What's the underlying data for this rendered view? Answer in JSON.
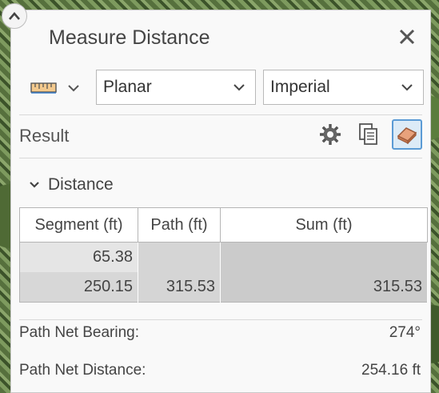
{
  "window": {
    "title": "Measure Distance"
  },
  "toolbar": {
    "mode_selected": "Planar",
    "units_selected": "Imperial"
  },
  "result": {
    "label": "Result"
  },
  "distance": {
    "section_label": "Distance",
    "headers": [
      "Segment (ft)",
      "Path (ft)",
      "Sum (ft)"
    ],
    "rows": [
      {
        "segment": "65.38",
        "path": "",
        "sum": ""
      },
      {
        "segment": "250.15",
        "path": "315.53",
        "sum": "315.53"
      }
    ]
  },
  "summary": {
    "bearing_label": "Path Net Bearing:",
    "bearing_value": "274°",
    "distance_label": "Path Net Distance:",
    "distance_value": "254.16 ft"
  },
  "colors": {
    "accent": "#5b9bd5",
    "eraser": "#e8a27c"
  }
}
